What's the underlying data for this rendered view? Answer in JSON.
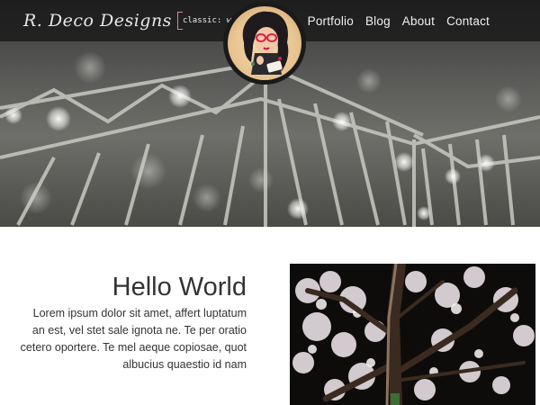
{
  "header": {
    "logo_text": "R. Deco Designs",
    "logo_tagline": "classic: web design;",
    "nav": [
      {
        "label": "Portfolio"
      },
      {
        "label": "Blog"
      },
      {
        "label": "About"
      },
      {
        "label": "Contact"
      }
    ]
  },
  "intro": {
    "heading": "Hello World",
    "body": "Lorem ipsum dolor sit amet, affert luptatum an est, vel stet sale ignota ne. Te per oratio cetero oportere. Te mel aeque copiosae, quot albucius quaestio id nam"
  },
  "colors": {
    "accent": "#e27ea8",
    "navbar_bg": "#141414",
    "text": "#333333"
  }
}
